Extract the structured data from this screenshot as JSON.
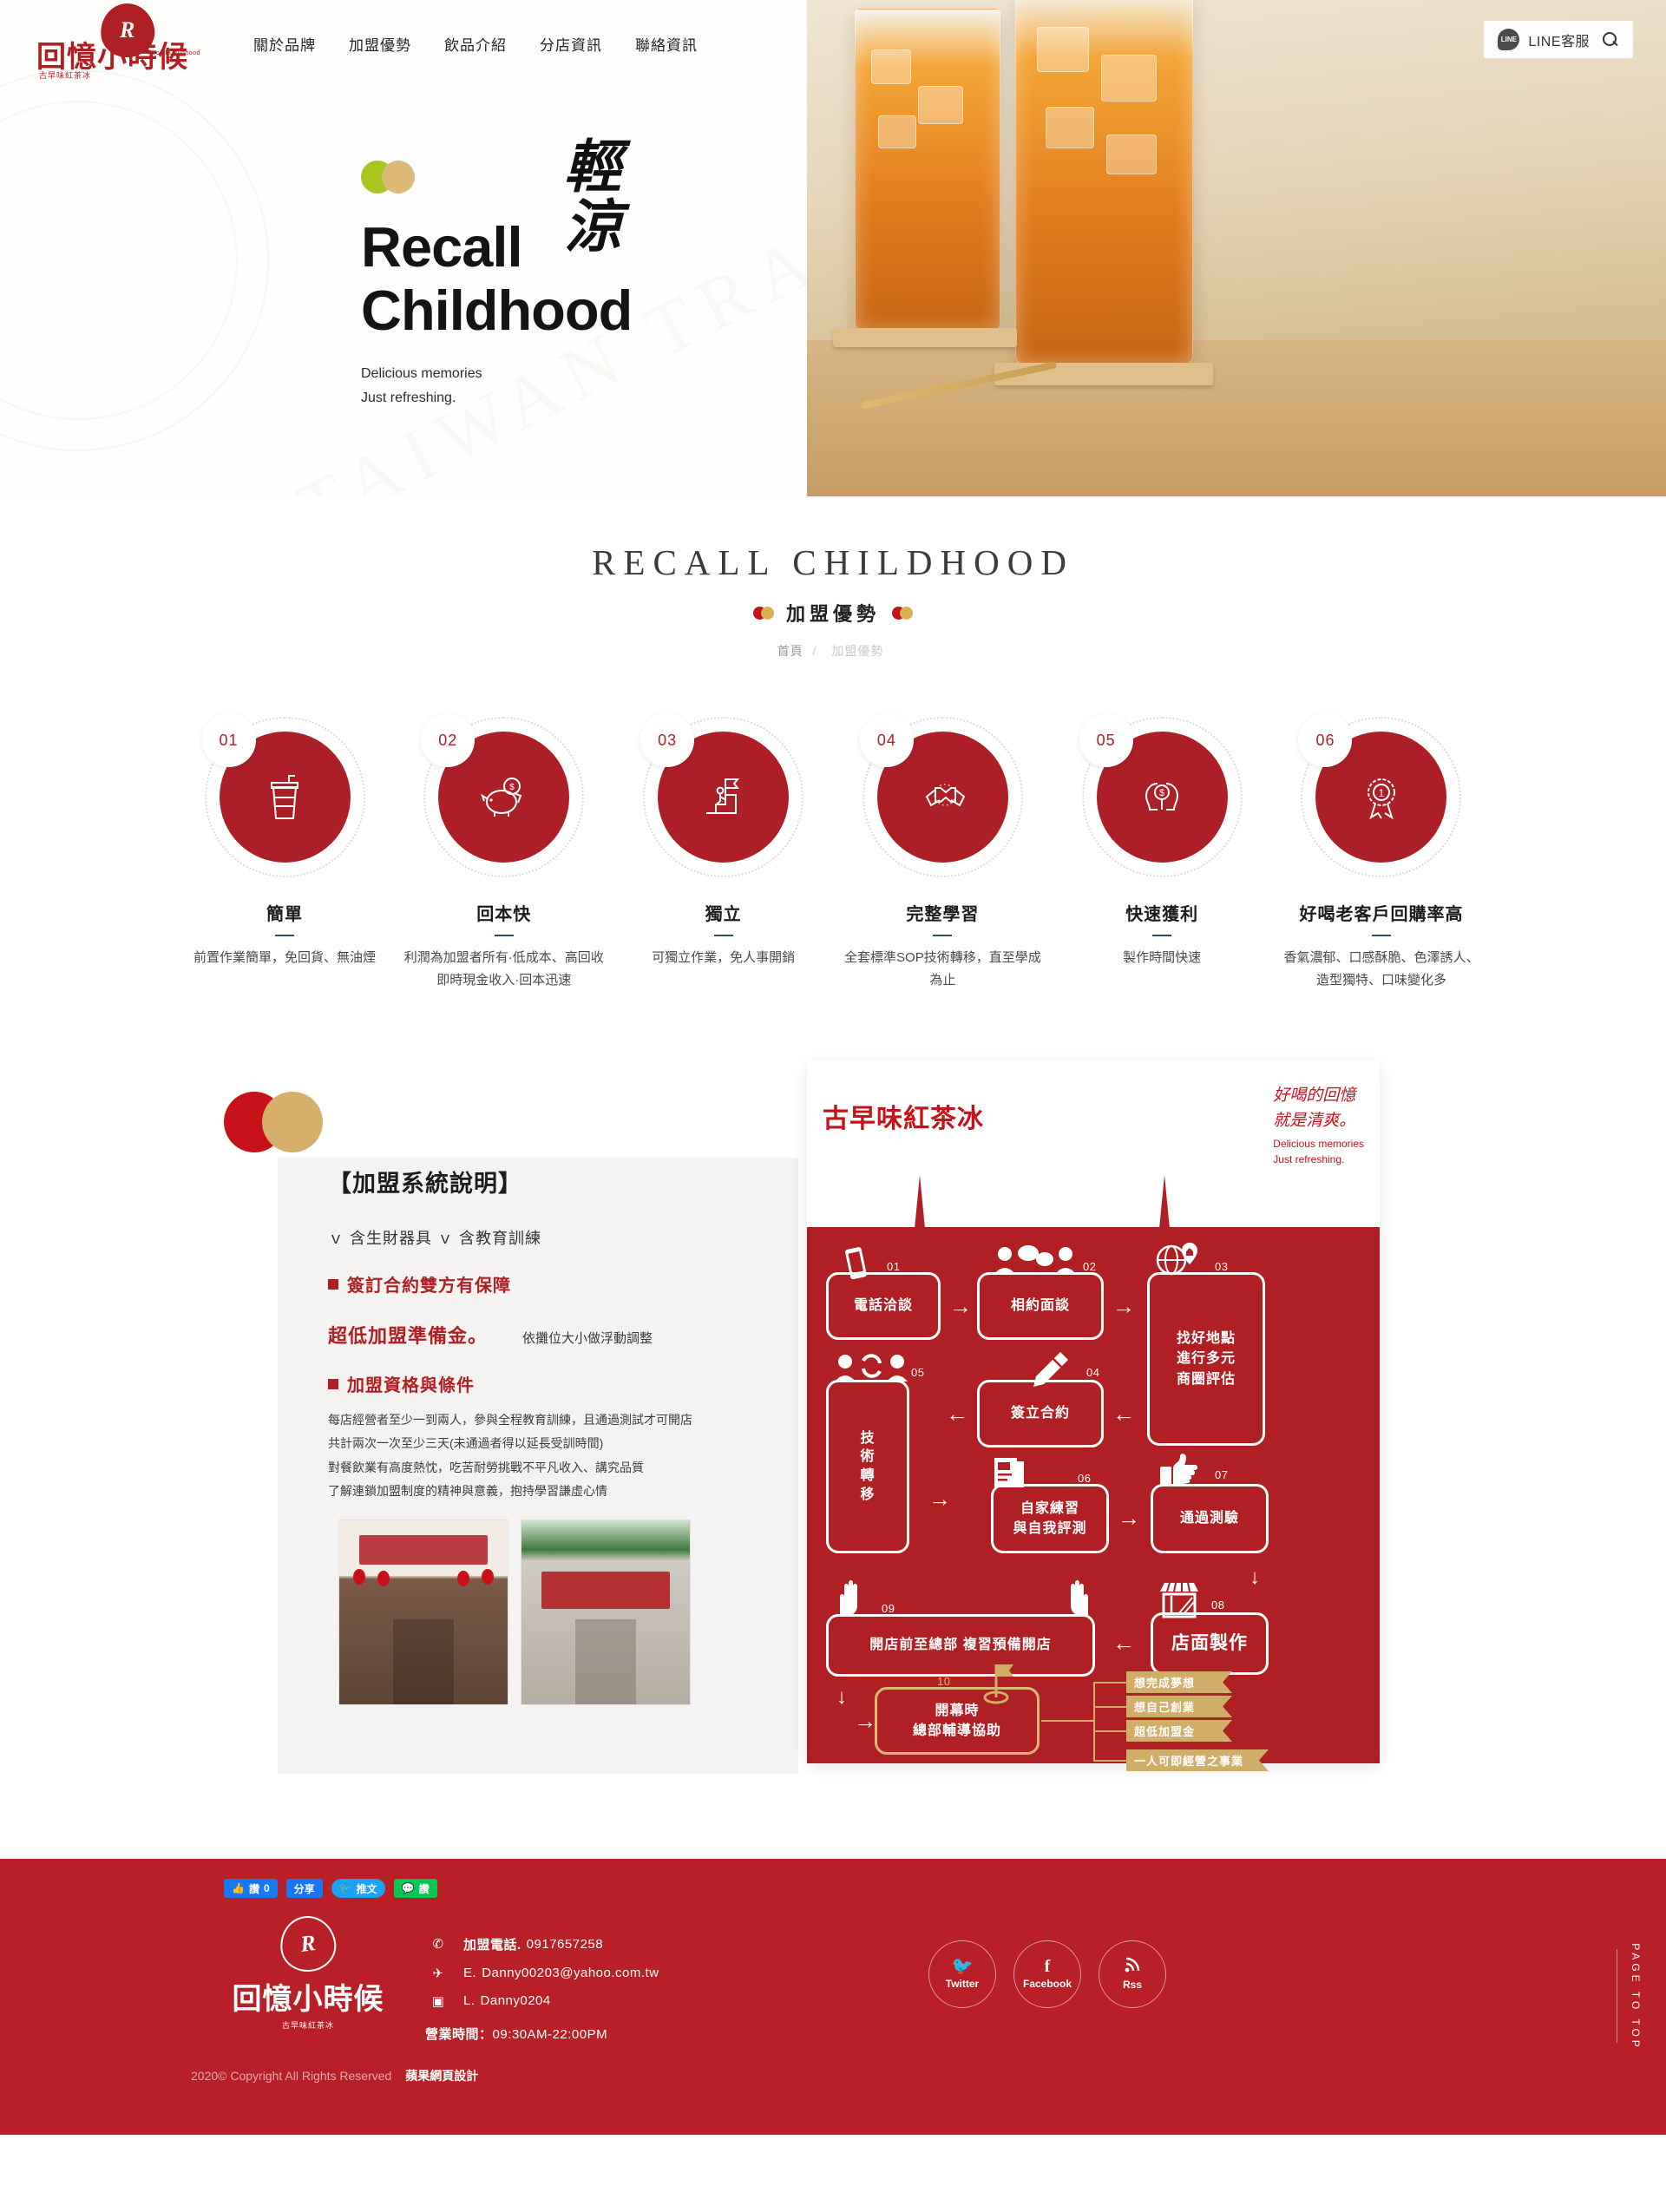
{
  "header": {
    "logo": {
      "mark": "R",
      "cn": "回憶小時候",
      "sub": "古早味紅茶冰",
      "en": "Recall Childhood"
    },
    "nav": [
      {
        "label": "關於品牌"
      },
      {
        "label": "加盟優勢"
      },
      {
        "label": "飲品介紹"
      },
      {
        "label": "分店資訊"
      },
      {
        "label": "聯絡資訊"
      }
    ],
    "line_badge": "LINE",
    "line_label": "LINE客服",
    "search_icon": "search-icon"
  },
  "hero": {
    "title_line1": "Recall",
    "title_line2": "Childhood",
    "subtitle_line1": "Delicious memories",
    "subtitle_line2": "Just refreshing.",
    "calligraphy_line1": "輕",
    "calligraphy_line2": "涼",
    "watermark": "TAIWAN TRADITIONAL BLACK TEA",
    "dot_green": "#a8c520",
    "dot_tan": "#dcb977"
  },
  "section": {
    "title_en": "RECALL CHILDHOOD",
    "title_cn": "加盟優勢",
    "breadcrumb_home": "首頁",
    "breadcrumb_sep": "/",
    "breadcrumb_current": "加盟優勢"
  },
  "features": [
    {
      "num": "01",
      "icon": "drink-cup-icon",
      "glyph": "🥤",
      "title": "簡單",
      "desc": "前置作業簡單，免回貨、無油煙"
    },
    {
      "num": "02",
      "icon": "piggy-bank-icon",
      "glyph": "🐷",
      "title": "回本快",
      "desc": "利潤為加盟者所有·低成本、高回收即時現金收入·回本迅速"
    },
    {
      "num": "03",
      "icon": "flag-stairs-icon",
      "glyph": "🚩",
      "title": "獨立",
      "desc": "可獨立作業，免人事開銷"
    },
    {
      "num": "04",
      "icon": "handshake-icon",
      "glyph": "🤝",
      "title": "完整學習",
      "desc": "全套標準SOP技術轉移，直至學成為止"
    },
    {
      "num": "05",
      "icon": "head-money-icon",
      "glyph": "💡",
      "title": "快速獲利",
      "desc": "製作時間快速"
    },
    {
      "num": "06",
      "icon": "award-ribbon-icon",
      "glyph": "🏅",
      "title": "好喝老客戶回購率高",
      "desc": "香氣濃郁、口感酥脆、色澤誘人、造型獨特、口味變化多"
    }
  ],
  "info": {
    "heading": "【加盟系統說明】",
    "checks": "ｖ 含生財器具 ｖ 含教育訓練",
    "bullet1": "簽訂合約雙方有保障",
    "fee_big": "超低加盟準備金。",
    "fee_note": "依攤位大小做浮動調整",
    "bullet2": "加盟資格與條件",
    "conditions": [
      "每店經營者至少一到兩人，參與全程教育訓練，且通過測試才可開店",
      "共計兩次一次至少三天(未通過者得以延長受訓時間)",
      "對餐飲業有高度熱忱，吃苦耐勞挑戰不平凡收入、講究品質",
      "了解連鎖加盟制度的精神與意義，抱持學習謙虛心情"
    ],
    "photos": [
      "storefront-interior-photo",
      "storefront-exterior-photo"
    ]
  },
  "flowchart": {
    "title": "古早味紅茶冰",
    "handwritten_line1": "好喝的回憶",
    "handwritten_line2": "就是清爽。",
    "tagline_line1": "Delicious memories",
    "tagline_line2": "Just refreshing.",
    "steps": [
      {
        "num": "01",
        "label": "電話洽談",
        "icon": "mobile-phone-icon",
        "glyph": "📱"
      },
      {
        "num": "02",
        "label": "相約面談",
        "icon": "people-talking-icon",
        "glyph": "💬"
      },
      {
        "num": "03",
        "label": "找好地點\n進行多元\n商圈評估",
        "icon": "globe-location-icon",
        "glyph": "🌐"
      },
      {
        "num": "04",
        "label": "簽立合約",
        "icon": "signing-pen-icon",
        "glyph": "✒"
      },
      {
        "num": "05",
        "label": "技\n術\n轉\n移",
        "icon": "knowledge-transfer-icon",
        "glyph": "🔄"
      },
      {
        "num": "06",
        "label": "自家練習\n與自我評測",
        "icon": "document-icon",
        "glyph": "📄"
      },
      {
        "num": "07",
        "label": "通過測驗",
        "icon": "thumbs-up-icon",
        "glyph": "👍"
      },
      {
        "num": "08",
        "label": "店面製作",
        "icon": "storefront-icon",
        "glyph": "🏪"
      },
      {
        "num": "09",
        "label": "開店前至總部 複習預備開店",
        "icon": "hands-icon",
        "glyph": "🙌"
      },
      {
        "num": "10",
        "label": "開幕時\n總部輔導協助",
        "icon": "flag-goal-icon",
        "glyph": "⛳"
      }
    ],
    "banners": [
      "想完成夢想",
      "想自己創業",
      "超低加盟金",
      "一人可即經營之事業"
    ],
    "brand_red": "#b01f24",
    "gold": "#d0ae68"
  },
  "share": [
    {
      "name": "facebook-like",
      "icon": "thumbs-up-icon",
      "glyph": "👍",
      "label": "讚",
      "count": "0",
      "color": "#1877f2"
    },
    {
      "name": "facebook-share",
      "icon": "share-icon",
      "glyph": "",
      "label": "分享",
      "count": "",
      "color": "#1877f2"
    },
    {
      "name": "twitter-tweet",
      "icon": "twitter-bird-icon",
      "glyph": "🐦",
      "label": "推文",
      "count": "",
      "color": "#1da1f2"
    },
    {
      "name": "line-like",
      "icon": "line-chat-icon",
      "glyph": "💬",
      "label": "讚",
      "count": "",
      "color": "#06c755"
    }
  ],
  "footer": {
    "logo": {
      "mark": "R",
      "cn": "回憶小時候",
      "sub": "古早味紅茶冰"
    },
    "copyright": "2020© Copyright All Rights Reserved",
    "designer": "蘋果網頁設計",
    "contacts": [
      {
        "icon": "phone-icon",
        "glyph": "📞",
        "label": "加盟電話.",
        "value": "0917657258"
      },
      {
        "icon": "paper-plane-icon",
        "glyph": "✈",
        "label": "E.",
        "value": "Danny00203@yahoo.com.tw"
      },
      {
        "icon": "line-icon",
        "glyph": "▣",
        "label": "L.",
        "value": "Danny0204"
      }
    ],
    "hours_label": "營業時間：",
    "hours_value": "09:30AM-22:00PM",
    "social": [
      {
        "icon": "twitter-bird-icon",
        "glyph": "🐦",
        "label": "Twitter"
      },
      {
        "icon": "facebook-f-icon",
        "glyph": "f",
        "label": "Facebook"
      },
      {
        "icon": "rss-icon",
        "glyph": "📶",
        "label": "Rss"
      }
    ],
    "to_top": "PAGE TO TOP"
  }
}
